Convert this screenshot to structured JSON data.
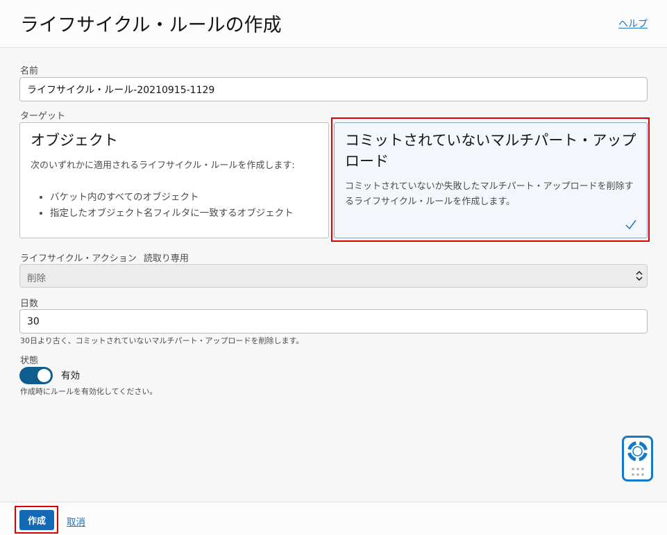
{
  "header": {
    "title": "ライフサイクル・ルールの作成",
    "help_link": "ヘルプ"
  },
  "form": {
    "name": {
      "label": "名前",
      "value": "ライフサイクル・ルール-20210915-1129"
    },
    "target": {
      "label": "ターゲット",
      "cards": [
        {
          "title": "オブジェクト",
          "description": "次のいずれかに適用されるライフサイクル・ルールを作成します:",
          "bullets": [
            "バケット内のすべてのオブジェクト",
            "指定したオブジェクト名フィルタに一致するオブジェクト"
          ],
          "selected": false
        },
        {
          "title": "コミットされていないマルチパート・アップロード",
          "description": "コミットされていないか失敗したマルチパート・アップロードを削除するライフサイクル・ルールを作成します。",
          "selected": true
        }
      ]
    },
    "action": {
      "label": "ライフサイクル・アクション",
      "readonly_tag": "読取り専用",
      "value": "削除"
    },
    "days": {
      "label": "日数",
      "value": "30",
      "hint": "30日より古く、コミットされていないマルチパート・アップロードを削除します。"
    },
    "state": {
      "label": "状態",
      "toggle_label": "有効",
      "enabled": true,
      "hint": "作成時にルールを有効化してください。"
    }
  },
  "footer": {
    "create_label": "作成",
    "cancel_label": "取消"
  },
  "colors": {
    "primary": "#1369b3",
    "link": "#1e73be",
    "toggle_on": "#0f5d8f",
    "highlight": "#d80000",
    "selected_card_bg": "#f3f7fb"
  },
  "icons": {
    "selected_check": "check-icon",
    "select_arrows": "chevron-up-down-icon",
    "help_widget": "lifebuoy-icon",
    "widget_grip": "grip-dots-icon"
  }
}
